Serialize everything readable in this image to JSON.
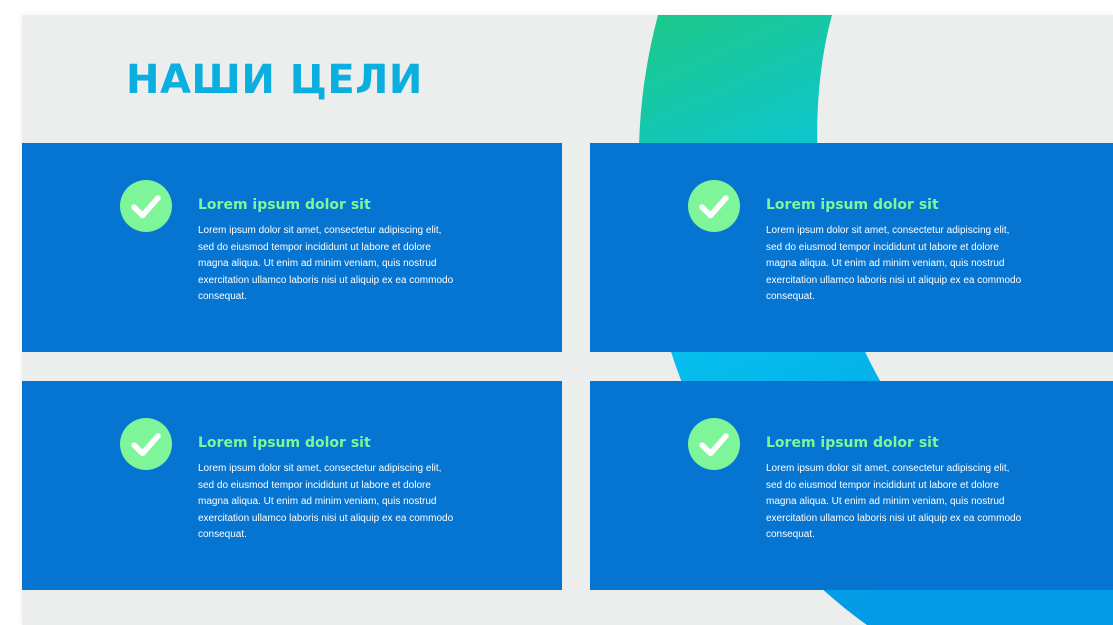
{
  "title": "НАШИ ЦЕЛИ",
  "colors": {
    "title": "#0aaedf",
    "card_background": "#0674d1",
    "check_circle": "#7ff59a",
    "card_title": "#7ff59a",
    "slide_background": "#eceeee",
    "arc_gradient": [
      "#1dc987",
      "#06c3ef",
      "#039be5"
    ]
  },
  "cards": [
    {
      "icon": "check-circle-icon",
      "title": "Lorem ipsum dolor sit",
      "text": "Lorem ipsum dolor sit amet, consectetur adipiscing elit, sed do eiusmod tempor incididunt ut labore et dolore magna aliqua. Ut enim ad minim veniam, quis nostrud exercitation ullamco laboris nisi ut aliquip ex ea commodo consequat."
    },
    {
      "icon": "check-circle-icon",
      "title": "Lorem ipsum dolor sit",
      "text": "Lorem ipsum dolor sit amet, consectetur adipiscing elit, sed do eiusmod tempor incididunt ut labore et dolore magna aliqua. Ut enim ad minim veniam, quis nostrud exercitation ullamco laboris nisi ut aliquip ex ea commodo consequat."
    },
    {
      "icon": "check-circle-icon",
      "title": "Lorem ipsum dolor sit",
      "text": "Lorem ipsum dolor sit amet, consectetur adipiscing elit, sed do eiusmod tempor incididunt ut labore et dolore magna aliqua. Ut enim ad minim veniam, quis nostrud exercitation ullamco laboris nisi ut aliquip ex ea commodo consequat."
    },
    {
      "icon": "check-circle-icon",
      "title": "Lorem ipsum dolor sit",
      "text": "Lorem ipsum dolor sit amet, consectetur adipiscing elit, sed do eiusmod tempor incididunt ut labore et dolore magna aliqua. Ut enim ad minim veniam, quis nostrud exercitation ullamco laboris nisi ut aliquip ex ea commodo consequat."
    }
  ]
}
